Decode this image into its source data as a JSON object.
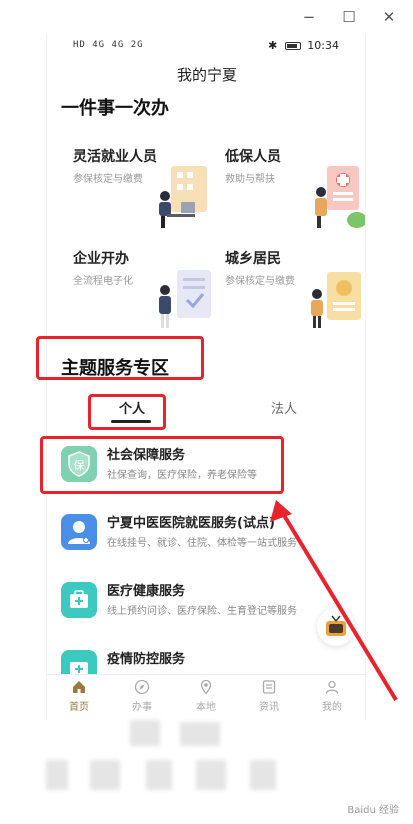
{
  "window": {
    "controls": {
      "minimize": "−",
      "maximize": "☐",
      "close": "✕"
    }
  },
  "statusbar": {
    "left": "HD 4G 4G 2G",
    "time": "10:34",
    "bluetooth": "✱"
  },
  "app_title": "我的宁夏",
  "section1": {
    "title": "一件事一次办",
    "cards": [
      {
        "title": "灵活就业人员",
        "subtitle": "参保核定与缴费",
        "icon": "office-worker-illustration"
      },
      {
        "title": "低保人员",
        "subtitle": "救助与帮扶",
        "icon": "assistance-illustration"
      },
      {
        "title": "企业开办",
        "subtitle": "全流程电子化",
        "icon": "business-startup-illustration"
      },
      {
        "title": "城乡居民",
        "subtitle": "参保核定与缴费",
        "icon": "resident-illustration"
      }
    ]
  },
  "section2": {
    "title": "主题服务专区",
    "tabs": [
      {
        "label": "个人",
        "active": true
      },
      {
        "label": "法人",
        "active": false
      }
    ],
    "services": [
      {
        "title": "社会保障服务",
        "subtitle": "社保查询，医疗保险，养老保险等",
        "icon": "shield-icon",
        "icon_char": "保",
        "color": "#7fd1b1"
      },
      {
        "title": "宁夏中医医院就医服务(试点)",
        "subtitle": "在线挂号、就诊、住院、体检等一站式服务",
        "icon": "doctor-icon",
        "color": "#4a8fe7"
      },
      {
        "title": "医疗健康服务",
        "subtitle": "线上预约问诊、医疗保险、生育登记等服务",
        "icon": "medical-kit-icon",
        "color": "#3cc9c0"
      },
      {
        "title": "疫情防控服务",
        "subtitle": "",
        "icon": "epidemic-icon",
        "color": "#3cc9c0"
      }
    ]
  },
  "bottom_nav": [
    {
      "label": "首页",
      "icon": "home-icon",
      "active": true
    },
    {
      "label": "办事",
      "icon": "compass-icon",
      "active": false
    },
    {
      "label": "本地",
      "icon": "location-icon",
      "active": false
    },
    {
      "label": "资讯",
      "icon": "news-icon",
      "active": false
    },
    {
      "label": "我的",
      "icon": "user-icon",
      "active": false
    }
  ],
  "watermark": "Baidu 经验"
}
